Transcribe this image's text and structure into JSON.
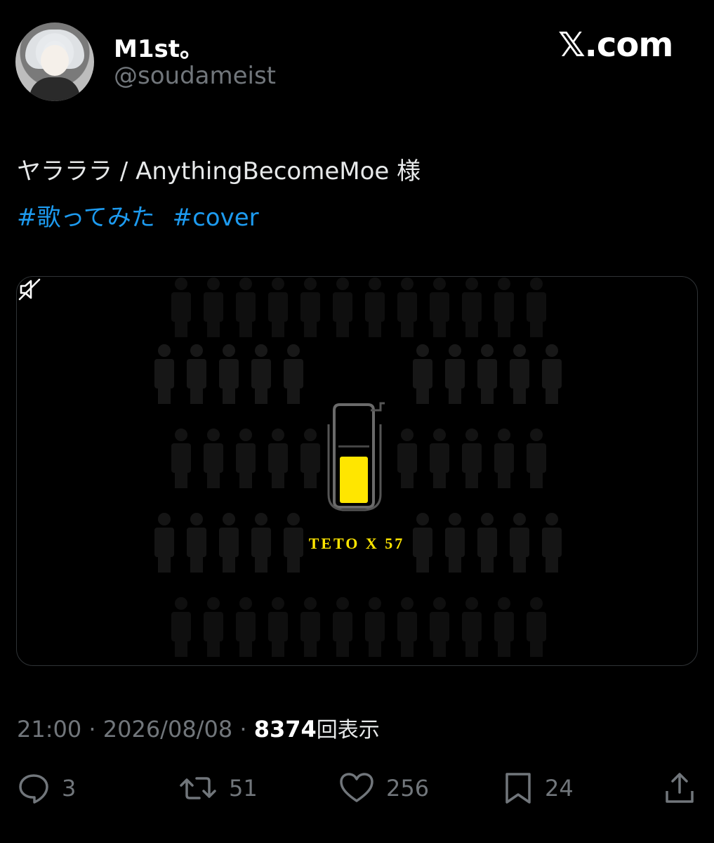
{
  "user": {
    "display_name": "M1st。",
    "handle": "@soudameist"
  },
  "site_logo": "𝕏.com",
  "tweet": {
    "text": "ヤラララ / AnythingBecomeMoe 様",
    "hashtags": [
      "#歌ってみた",
      "#cover"
    ]
  },
  "media": {
    "caption": "TETO X 57",
    "fill_level": 0.5,
    "accent_color": "#ffe600",
    "mute_icon": "speaker-muted-icon"
  },
  "meta": {
    "time": "21:00",
    "separator": "·",
    "date": "2026/08/08",
    "views_count": "8374",
    "views_label": "回表示"
  },
  "actions": {
    "replies": "3",
    "reposts": "51",
    "likes": "256",
    "bookmarks": "24"
  },
  "colors": {
    "link": "#1d9bf0",
    "muted": "#71767b",
    "text": "#e7e9ea"
  }
}
